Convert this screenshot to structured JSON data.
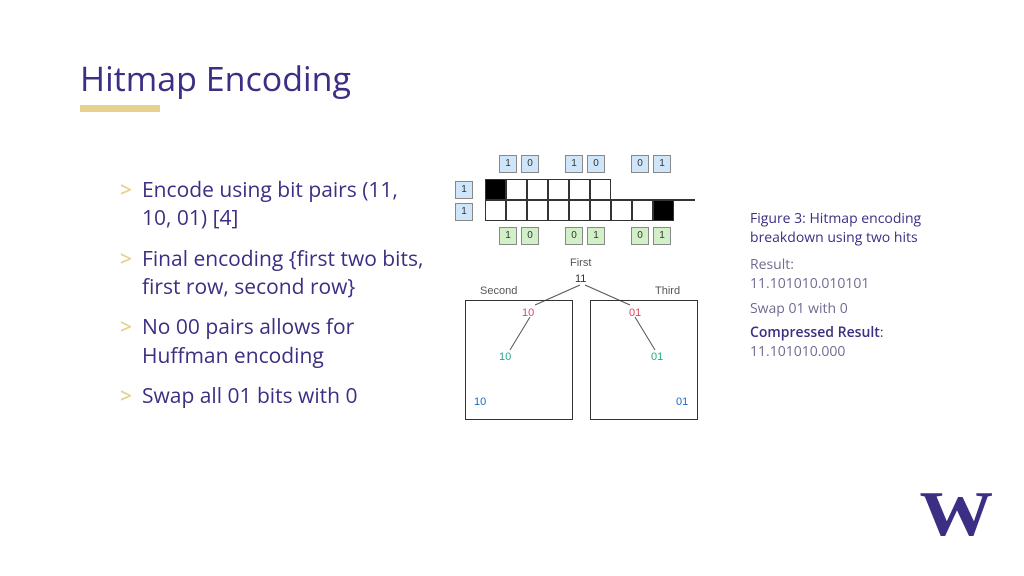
{
  "title": "Hitmap Encoding",
  "bullets": [
    "Encode using bit pairs (11, 10, 01) [4]",
    "Final encoding {first two bits, first row, second row}",
    "No 00 pairs allows for Huffman encoding",
    "Swap all 01 bits with 0"
  ],
  "diagram": {
    "top_bits": [
      [
        1,
        0
      ],
      [
        1,
        0
      ],
      [
        0,
        1
      ]
    ],
    "left_bits": [
      1,
      1
    ],
    "grid_row1": [
      1,
      0,
      0,
      0,
      0,
      0
    ],
    "grid_row2": [
      0,
      0,
      0,
      0,
      0,
      1
    ],
    "bottom_bits": [
      [
        1,
        0
      ],
      [
        0,
        1
      ],
      [
        0,
        1
      ]
    ],
    "labels": {
      "first": "First",
      "second": "Second",
      "third": "Third",
      "root": "11"
    },
    "tree_left": [
      "10",
      "10",
      "10"
    ],
    "tree_right": [
      "01",
      "01",
      "01"
    ]
  },
  "caption": {
    "title": "Figure 3: Hitmap encoding breakdown using two hits",
    "result_label": "Result:",
    "result_value": "11.101010.010101",
    "swap_text": "Swap 01 with 0",
    "compressed_label": "Compressed Result",
    "compressed_value": "11.101010.000"
  },
  "logo": "W"
}
